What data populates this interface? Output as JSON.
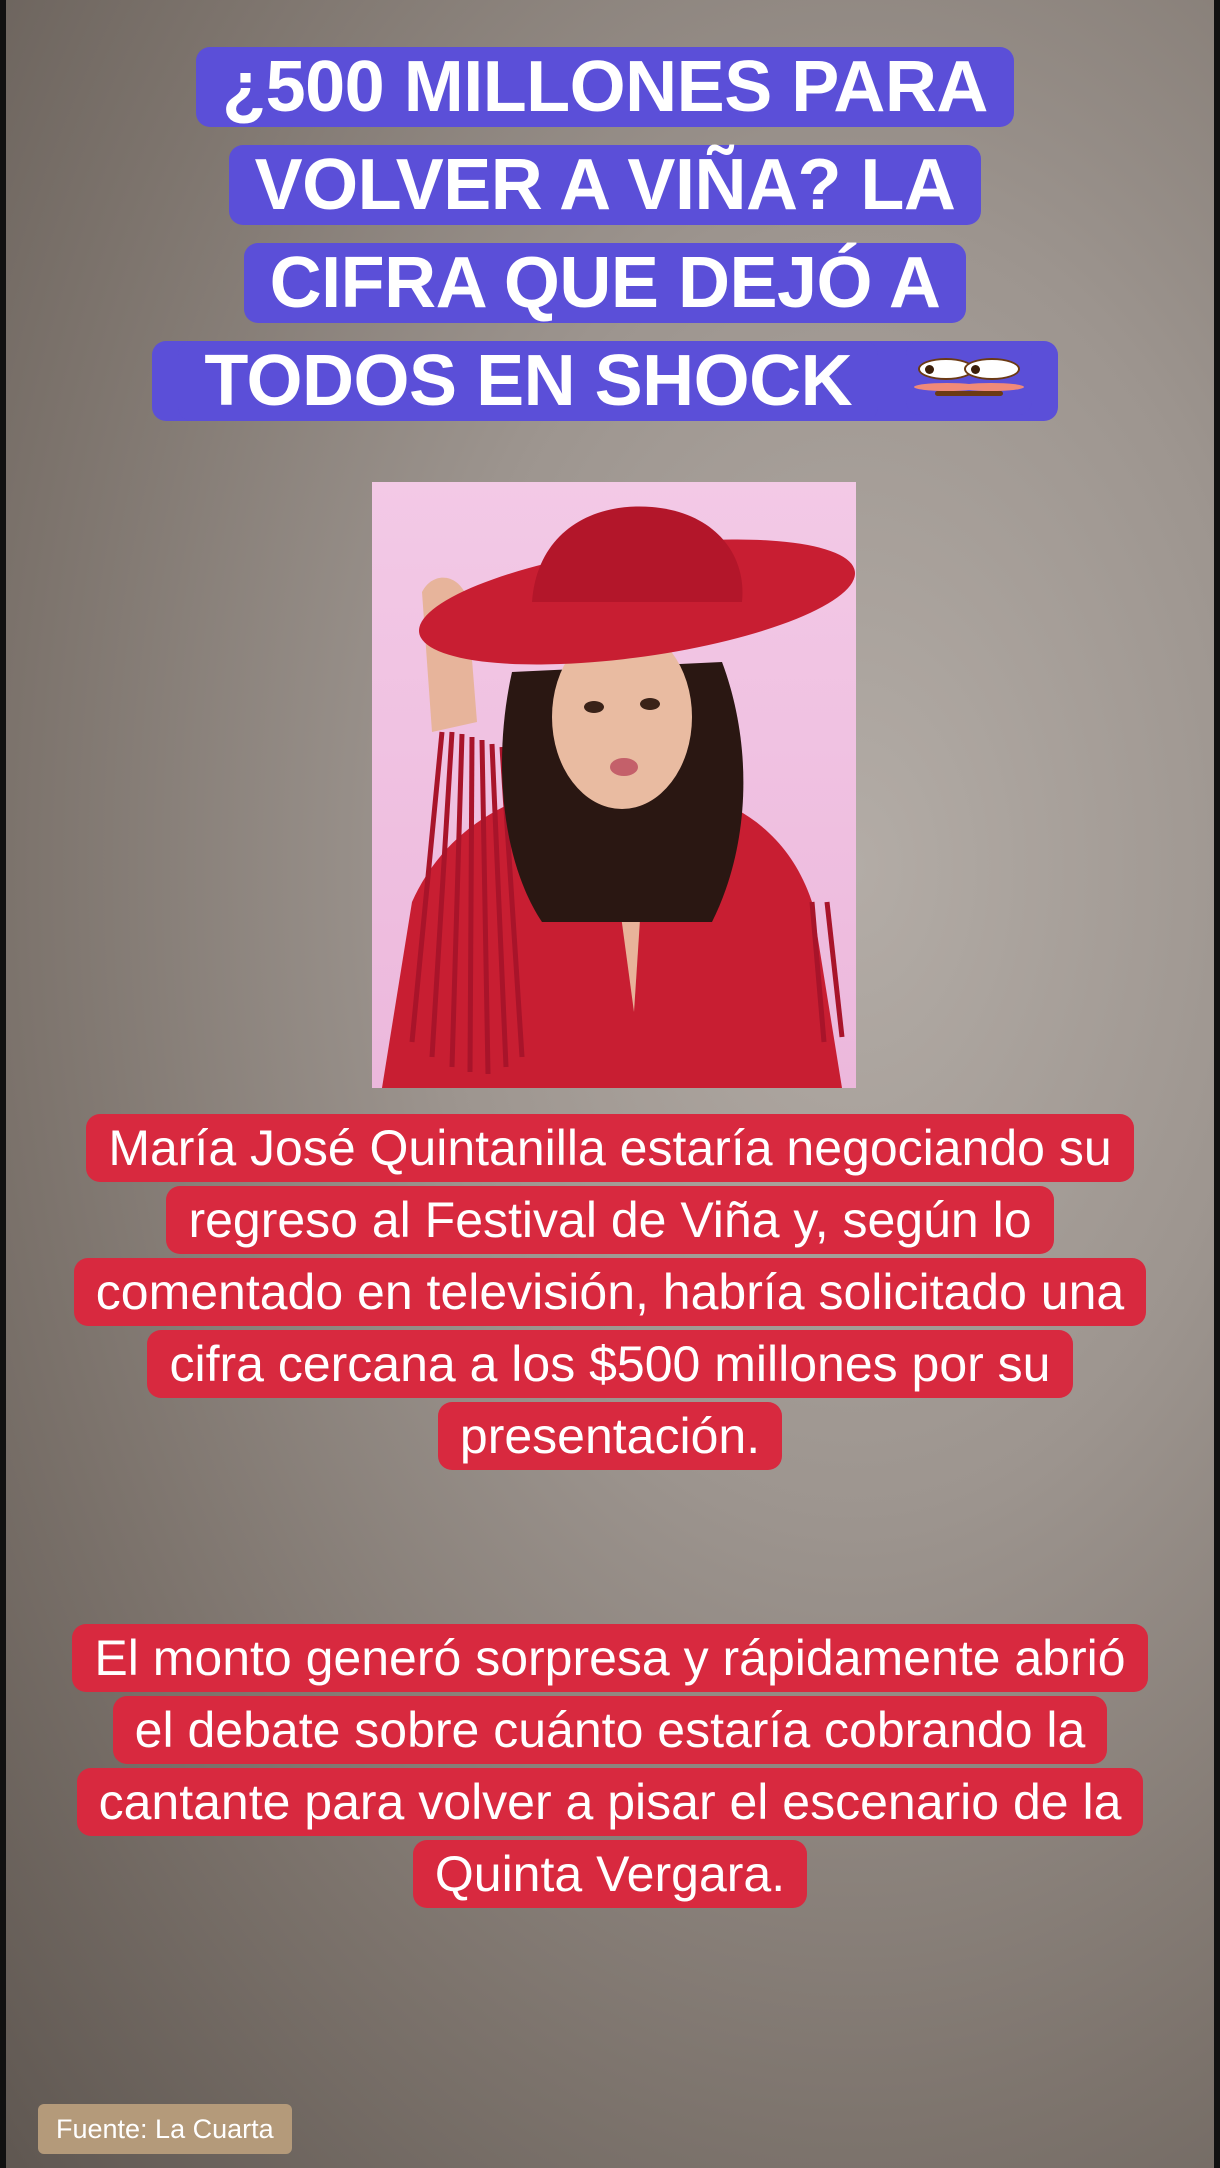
{
  "headline": {
    "lines": [
      "¿500 MILLONES PARA",
      "VOLVER A VIÑA? LA",
      "CIFRA QUE DEJÓ A",
      "TODOS EN SHOCK"
    ],
    "emoji_icon": "flushed-face-emoji"
  },
  "photo": {
    "icon": "woman-red-cowboy-hat-photo",
    "colors": {
      "background": "#f0c0e0",
      "outfit": "#c81e32"
    }
  },
  "paragraphs": [
    "María José Quintanilla estaría negociando su regreso al Festival de Viña y, según lo comentado en televisión, habría solicitado una cifra cercana a los $500 millones por su presentación.",
    "El monto generó sorpresa y rápidamente abrió el debate sobre cuánto estaría cobrando la cantante para volver a pisar el escenario de la Quinta Vergara."
  ],
  "source": "Fuente: La Cuarta",
  "colors": {
    "headline_bg": "#5b4fd8",
    "paragraph_bg": "#d8293f",
    "source_bg": "#b49a7a"
  }
}
